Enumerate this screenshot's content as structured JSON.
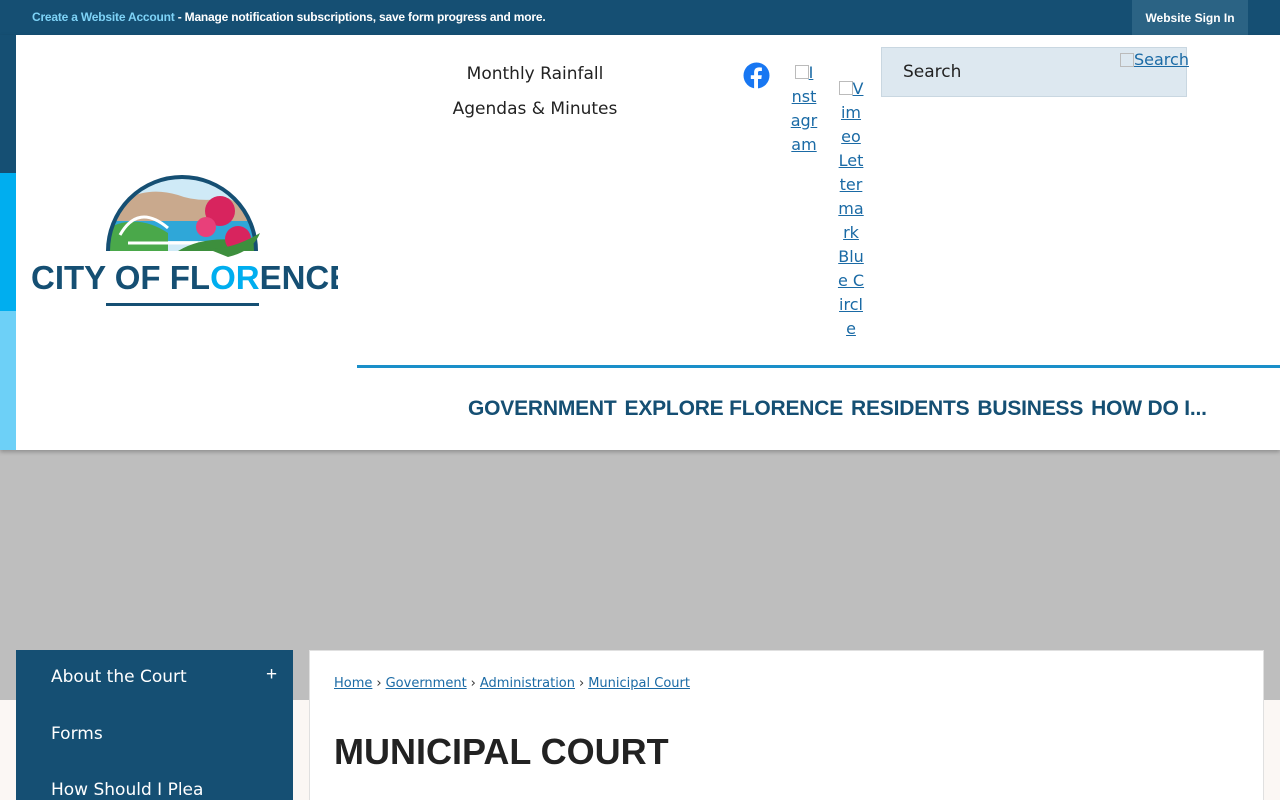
{
  "topbar": {
    "account_link": "Create a Website Account",
    "account_text": " - Manage notification subscriptions, save form progress and more.",
    "signin_label": "Website Sign In"
  },
  "header": {
    "logo_text_part1": "CITY OF FL",
    "logo_text_part2": "OR",
    "logo_text_part3": "ENCE",
    "quick_links": [
      "Monthly Rainfall",
      "Agendas & Minutes"
    ],
    "social": {
      "facebook": "facebook-icon",
      "instagram_alt": "Instagram",
      "vimeo_alt": "Vimeo Lettermark Blue Circle"
    },
    "search": {
      "placeholder": "Search",
      "button_alt": "Search"
    },
    "nav": [
      "GOVERNMENT",
      "EXPLORE FLORENCE",
      "RESIDENTS",
      "BUSINESS",
      "HOW DO I..."
    ]
  },
  "sidebar": {
    "items": [
      "About the Court",
      "Forms",
      "How Should I Plea"
    ],
    "toggle": "+"
  },
  "breadcrumb": {
    "items": [
      "Home",
      "Government",
      "Administration",
      "Municipal Court"
    ],
    "separator": "›"
  },
  "page": {
    "title": "MUNICIPAL COURT"
  },
  "colors": {
    "navy": "#154f73",
    "cyan": "#00aeef",
    "light_cyan": "#6dd0f7",
    "link": "#1a6aa5"
  }
}
